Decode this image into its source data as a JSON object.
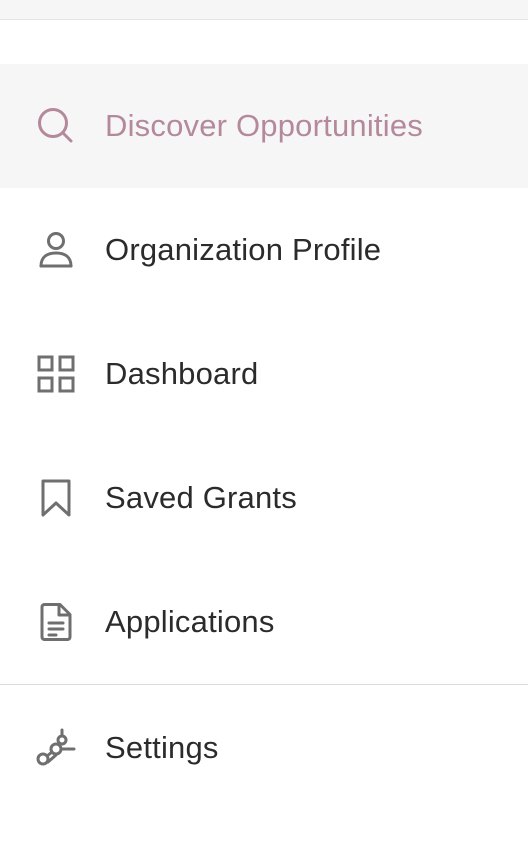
{
  "sidebar": {
    "items": [
      {
        "label": "Discover Opportunities",
        "icon": "search-icon",
        "active": true
      },
      {
        "label": "Organization Profile",
        "icon": "user-icon",
        "active": false
      },
      {
        "label": "Dashboard",
        "icon": "grid-icon",
        "active": false
      },
      {
        "label": "Saved Grants",
        "icon": "bookmark-icon",
        "active": false
      },
      {
        "label": "Applications",
        "icon": "document-icon",
        "active": false
      }
    ],
    "settings": {
      "label": "Settings",
      "icon": "settings-icon"
    }
  },
  "colors": {
    "active_text": "#b4899b",
    "text": "#2b2b2b",
    "icon": "#6f6f6f",
    "active_bg": "#f7f6f6",
    "divider": "#dcdad9"
  }
}
